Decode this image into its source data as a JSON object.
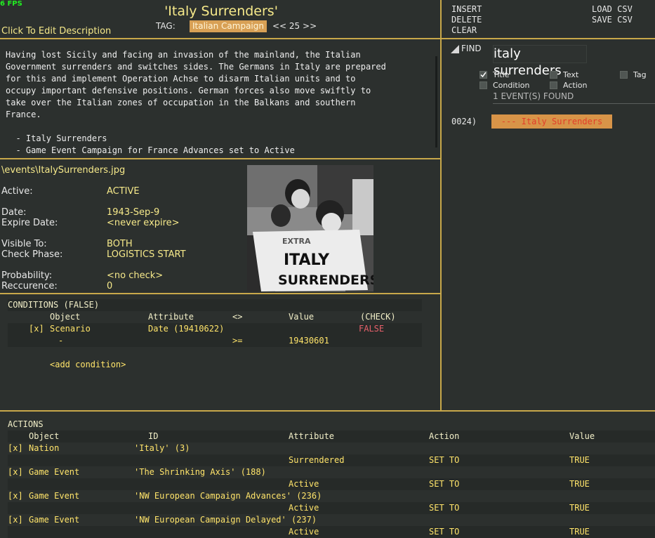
{
  "fps": "6 FPS",
  "event": {
    "title": "'Italy Surrenders'",
    "edit_description": "Click To Edit Description",
    "tag_label": "TAG:",
    "tag_value": "Italian Campaign",
    "nav": "<< 25 >>",
    "description": "Having lost Sicily and facing an invasion of the mainland, the Italian\nGovernment surrenders and switches sides. The Germans in Italy are prepared\nfor this and implement Operation Achse to disarm Italian units and to\noccupy important defensive positions. German forces also move swiftly to\ntake over the Italian zones of occupation in the Balkans and southern\nFrance.\n\n  - Italy Surrenders\n  - Game Event Campaign for France Advances set to Active"
  },
  "details": {
    "file": "\\events\\ItalySurrenders.jpg",
    "active_label": "Active:",
    "active_value": "ACTIVE",
    "date_label": "Date:",
    "date_value": "1943-Sep-9",
    "expire_label": "Expire Date:",
    "expire_value": "<never expire>",
    "visible_label": "Visible To:",
    "visible_value": "BOTH",
    "phase_label": "Check Phase:",
    "phase_value": "LOGISTICS START",
    "prob_label": "Probability:",
    "prob_value": "<no check>",
    "rec_label": "Reccurence:",
    "rec_value": "0",
    "image_headline_1": "ITALY",
    "image_headline_2": "SURRENDERS",
    "image_masthead": "EXTRA"
  },
  "conditions": {
    "title": "CONDITIONS (FALSE)",
    "headers": {
      "object": "Object",
      "attribute": "Attribute",
      "op": "<>",
      "value": "Value",
      "check": "(CHECK)"
    },
    "row1": {
      "mark": "[x]",
      "object": "Scenario",
      "attribute": "Date (19410622)",
      "check": "FALSE"
    },
    "row2": {
      "object": "-",
      "op": ">=",
      "value": "19430601"
    },
    "add": "<add condition>"
  },
  "actions": {
    "title": "ACTIONS",
    "headers": {
      "object": "Object",
      "id": "ID",
      "attribute": "Attribute",
      "action": "Action",
      "value": "Value"
    },
    "rows": [
      {
        "mark": "[x]",
        "object": "Nation",
        "id": "'Italy' (3)",
        "attribute": "Surrendered",
        "action": "SET TO",
        "value": "TRUE"
      },
      {
        "mark": "[x]",
        "object": "Game Event",
        "id": "'The Shrinking Axis' (188)",
        "attribute": "Active",
        "action": "SET TO",
        "value": "TRUE"
      },
      {
        "mark": "[x]",
        "object": "Game Event",
        "id": "'NW European Campaign Advances' (236)",
        "attribute": "Active",
        "action": "SET TO",
        "value": "TRUE"
      },
      {
        "mark": "[x]",
        "object": "Game Event",
        "id": "'NW European Campaign Delayed' (237)",
        "attribute": "Active",
        "action": "SET TO",
        "value": "TRUE"
      }
    ]
  },
  "right_panel": {
    "insert": "INSERT",
    "delete": "DELETE",
    "clear": "CLEAR",
    "load_csv": "LOAD CSV",
    "save_csv": "SAVE CSV",
    "find_label": "FIND",
    "search_value": "italy surrenders",
    "options": {
      "title": "Title",
      "text": "Text",
      "tag": "Tag",
      "condition": "Condition",
      "action": "Action"
    },
    "title_checked": true,
    "found": "1 EVENT(S) FOUND",
    "result_index": "0024)",
    "result_label": "--- Italy Surrenders"
  },
  "colors": {
    "accent": "#c8a84a",
    "chip": "#d8a055",
    "false": "#e5606a"
  }
}
